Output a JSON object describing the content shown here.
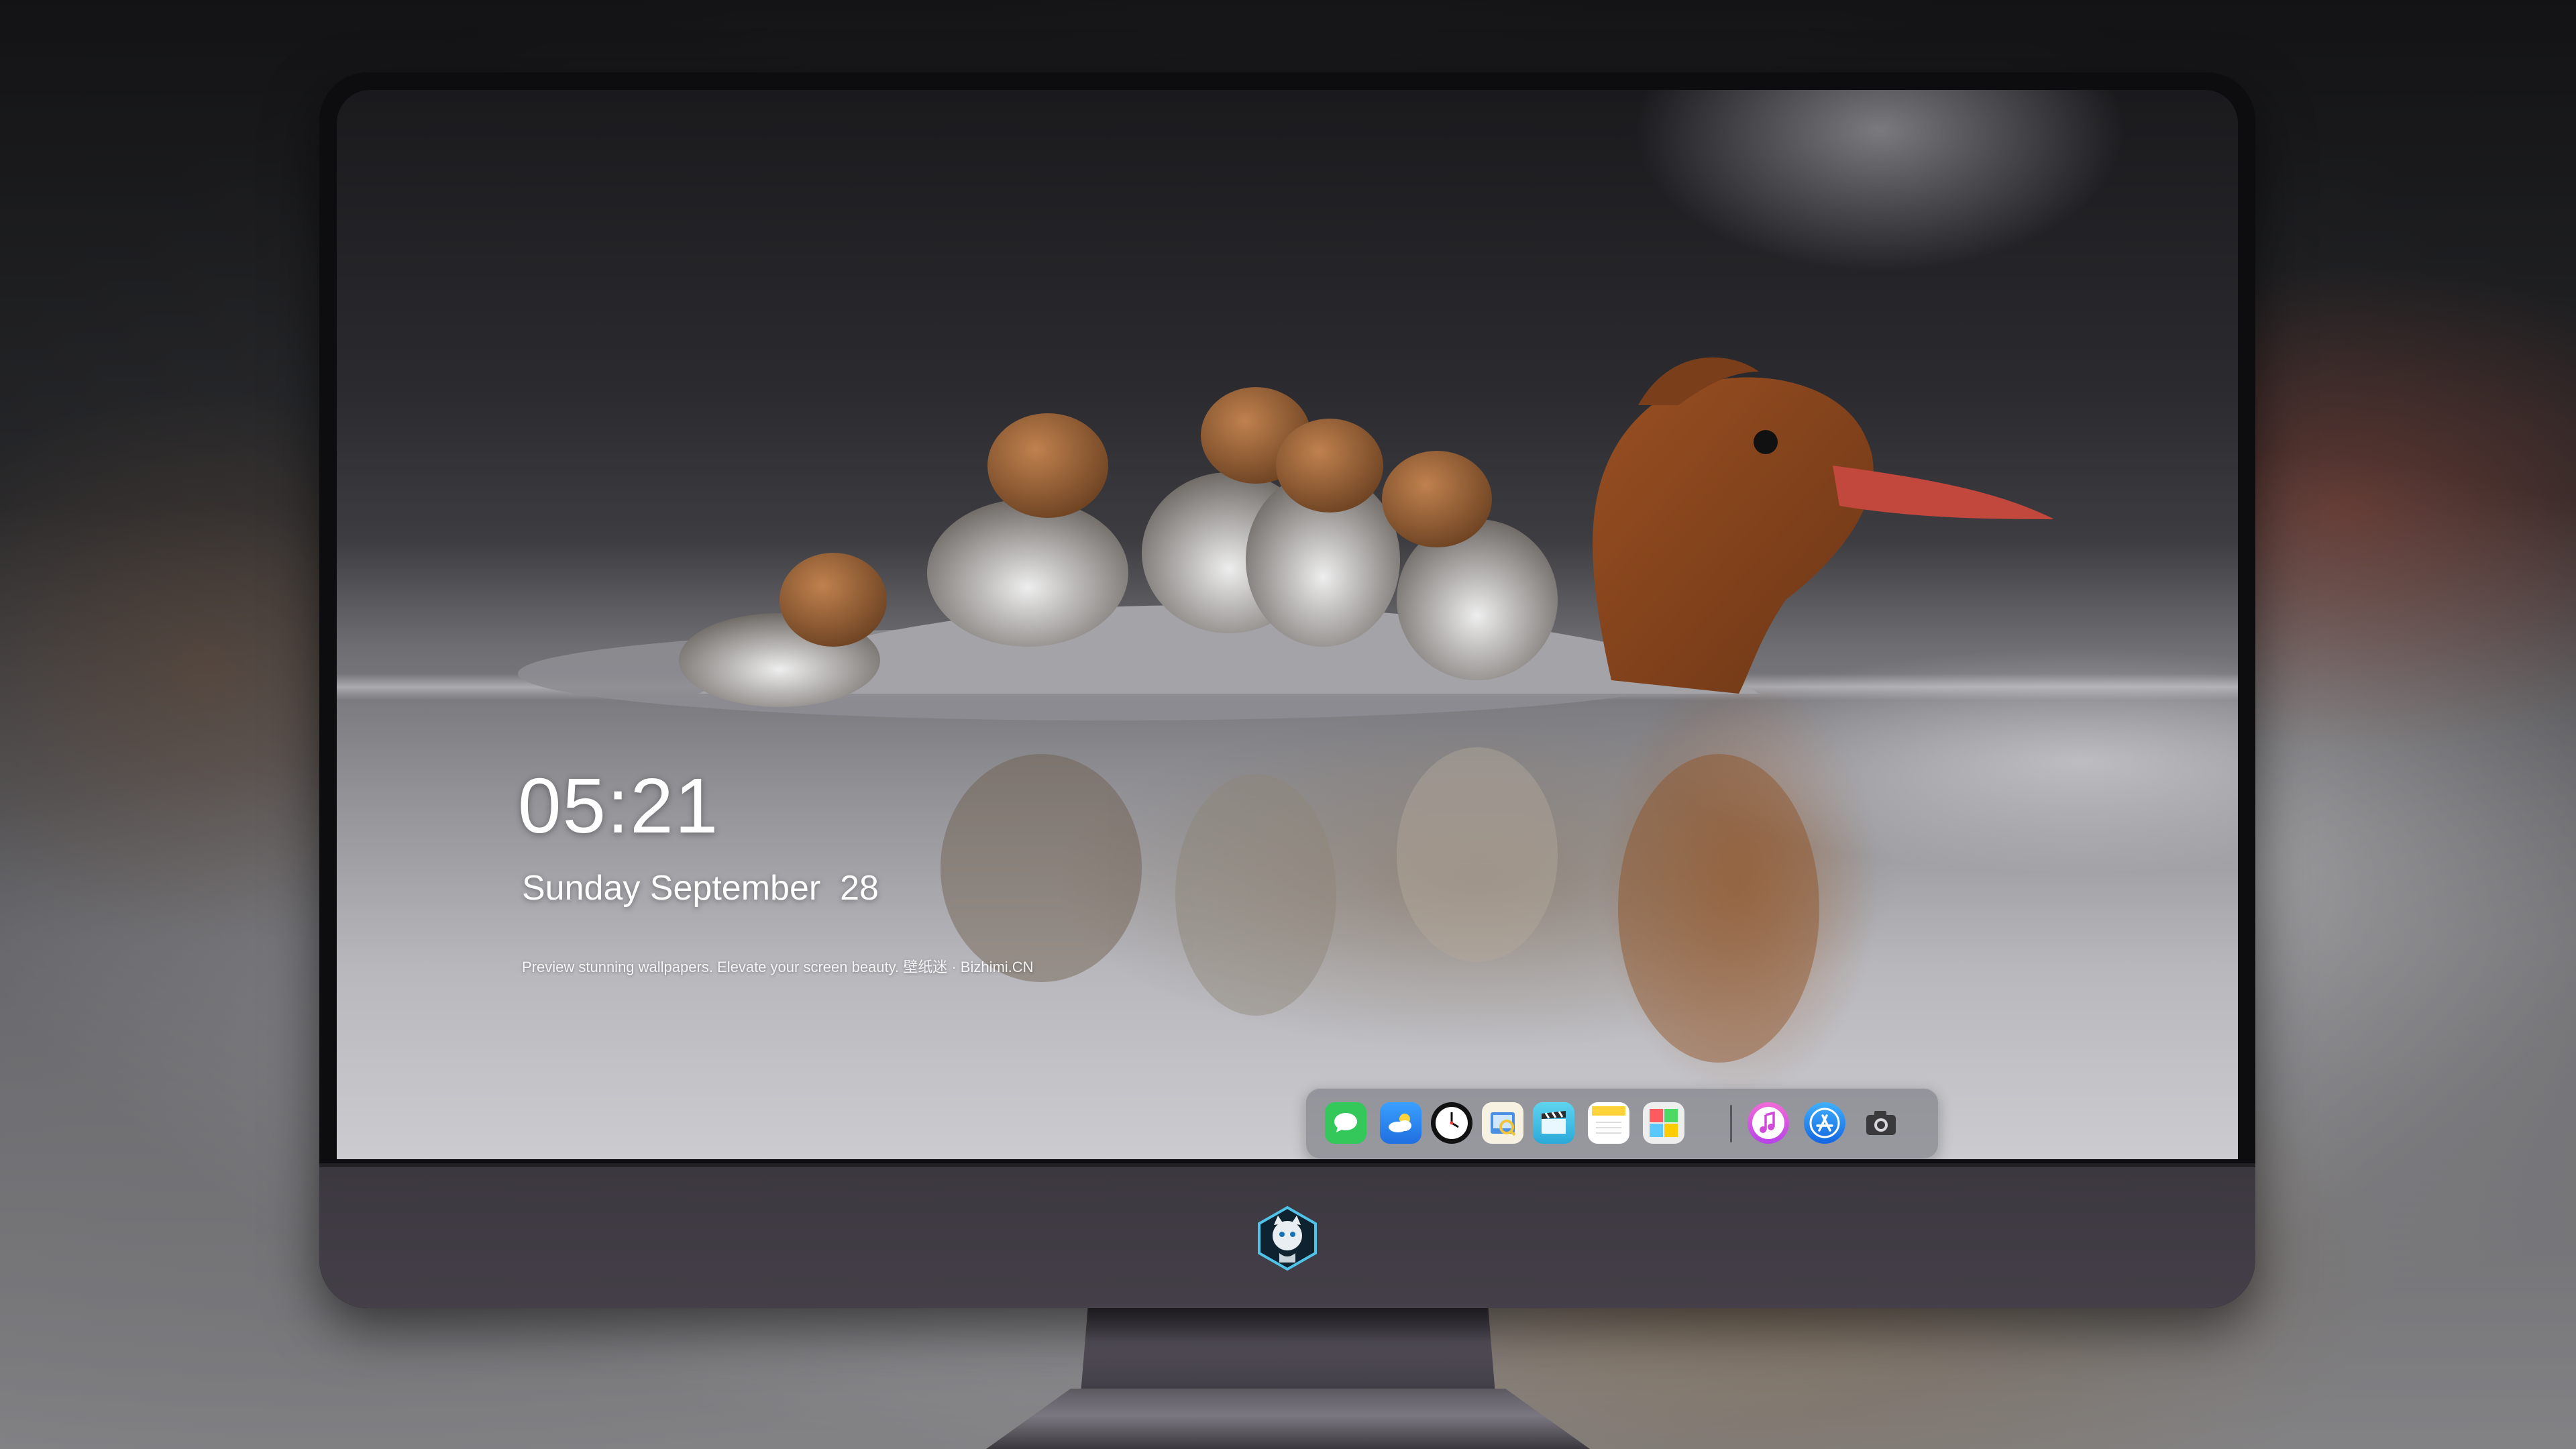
{
  "lockscreen": {
    "time": "05:21",
    "date": "Sunday September  28",
    "tagline": "Preview stunning wallpapers. Elevate your screen beauty. 壁纸迷 · Bizhimi.CN"
  },
  "dock": {
    "items": [
      {
        "name": "messages",
        "icon": "messages-icon",
        "color": "#34C759"
      },
      {
        "name": "weather",
        "icon": "weather-icon",
        "color": "#2F8CFF"
      },
      {
        "name": "clock",
        "icon": "clock-icon",
        "color": "#111111"
      },
      {
        "name": "preview",
        "icon": "preview-icon",
        "color": "#F3C43A"
      },
      {
        "name": "clips",
        "icon": "clapperboard-icon",
        "color": "#3EC4E8"
      },
      {
        "name": "notes",
        "icon": "notes-icon",
        "color": "#FFD43B"
      },
      {
        "name": "photo-booth",
        "icon": "photo-booth-icon",
        "color": "#E8E8E8"
      },
      {
        "name": "itunes",
        "icon": "music-note-icon",
        "color": "#E447E6"
      },
      {
        "name": "app-store",
        "icon": "app-store-icon",
        "color": "#1E90FF"
      },
      {
        "name": "camera",
        "icon": "camera-icon",
        "color": "#3A3A3C"
      }
    ]
  }
}
